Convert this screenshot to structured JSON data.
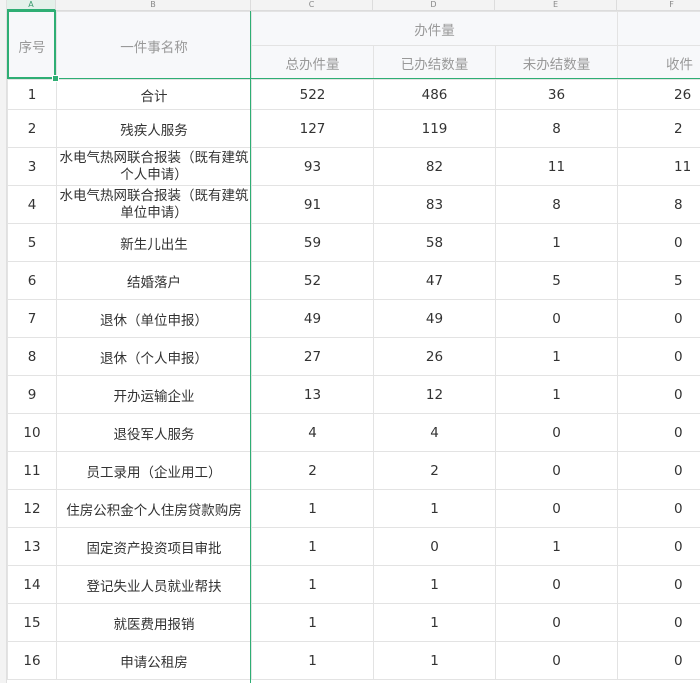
{
  "columns": [
    "A",
    "B",
    "C",
    "D",
    "E",
    "F"
  ],
  "header": {
    "seq": "序号",
    "name": "一件事名称",
    "group": "办件量",
    "total": "总办件量",
    "done": "已办结数量",
    "pending": "未办结数量",
    "received": "收件"
  },
  "rows": [
    {
      "seq": "1",
      "name": "合计",
      "total": "522",
      "done": "486",
      "pending": "36",
      "received": "26"
    },
    {
      "seq": "2",
      "name": "残疾人服务",
      "total": "127",
      "done": "119",
      "pending": "8",
      "received": "2"
    },
    {
      "seq": "3",
      "name": "水电气热网联合报装（既有建筑个人申请）",
      "total": "93",
      "done": "82",
      "pending": "11",
      "received": "11"
    },
    {
      "seq": "4",
      "name": "水电气热网联合报装（既有建筑单位申请）",
      "total": "91",
      "done": "83",
      "pending": "8",
      "received": "8"
    },
    {
      "seq": "5",
      "name": "新生儿出生",
      "total": "59",
      "done": "58",
      "pending": "1",
      "received": "0"
    },
    {
      "seq": "6",
      "name": "结婚落户",
      "total": "52",
      "done": "47",
      "pending": "5",
      "received": "5"
    },
    {
      "seq": "7",
      "name": "退休（单位申报）",
      "total": "49",
      "done": "49",
      "pending": "0",
      "received": "0"
    },
    {
      "seq": "8",
      "name": "退休（个人申报）",
      "total": "27",
      "done": "26",
      "pending": "1",
      "received": "0"
    },
    {
      "seq": "9",
      "name": "开办运输企业",
      "total": "13",
      "done": "12",
      "pending": "1",
      "received": "0"
    },
    {
      "seq": "10",
      "name": "退役军人服务",
      "total": "4",
      "done": "4",
      "pending": "0",
      "received": "0"
    },
    {
      "seq": "11",
      "name": "员工录用（企业用工）",
      "total": "2",
      "done": "2",
      "pending": "0",
      "received": "0"
    },
    {
      "seq": "12",
      "name": "住房公积金个人住房贷款购房",
      "total": "1",
      "done": "1",
      "pending": "0",
      "received": "0"
    },
    {
      "seq": "13",
      "name": "固定资产投资项目审批",
      "total": "1",
      "done": "0",
      "pending": "1",
      "received": "0"
    },
    {
      "seq": "14",
      "name": "登记失业人员就业帮扶",
      "total": "1",
      "done": "1",
      "pending": "0",
      "received": "0"
    },
    {
      "seq": "15",
      "name": "就医费用报销",
      "total": "1",
      "done": "1",
      "pending": "0",
      "received": "0"
    },
    {
      "seq": "16",
      "name": "申请公租房",
      "total": "1",
      "done": "1",
      "pending": "0",
      "received": "0"
    }
  ]
}
